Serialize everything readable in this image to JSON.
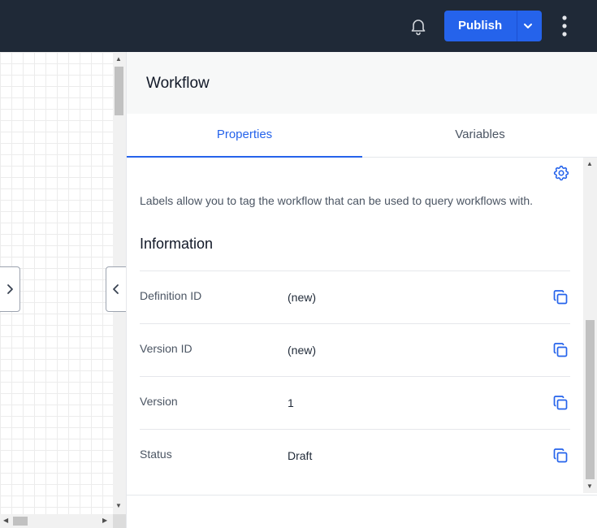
{
  "topbar": {
    "publish_label": "Publish",
    "icons": {
      "notifications": "bell-icon",
      "more": "vertical-ellipsis-icon",
      "dropdown": "chevron-down-icon"
    }
  },
  "colors": {
    "topbar_bg": "#1f2937",
    "accent": "#2563eb",
    "panel_header_bg": "#f7f8f8"
  },
  "panel": {
    "title": "Workflow",
    "tabs": [
      {
        "label": "Properties",
        "active": true
      },
      {
        "label": "Variables",
        "active": false
      }
    ],
    "labels_description": "Labels allow you to tag the workflow that can be used to query workflows with.",
    "information": {
      "heading": "Information",
      "rows": [
        {
          "label": "Definition ID",
          "value": "(new)"
        },
        {
          "label": "Version ID",
          "value": "(new)"
        },
        {
          "label": "Version",
          "value": "1"
        },
        {
          "label": "Status",
          "value": "Draft"
        }
      ]
    }
  }
}
